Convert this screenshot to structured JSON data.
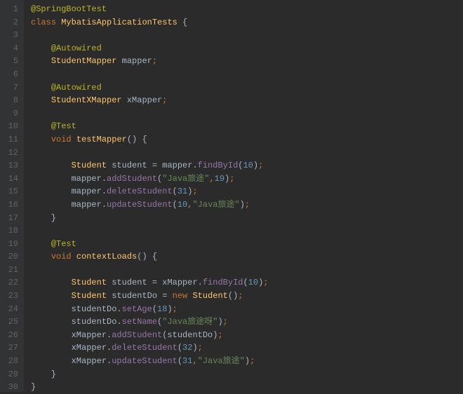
{
  "lines": [
    {
      "n": 1,
      "segs": [
        {
          "c": "annotation",
          "t": "@SpringBootTest"
        }
      ]
    },
    {
      "n": 2,
      "segs": [
        {
          "c": "keyword",
          "t": "class "
        },
        {
          "c": "type",
          "t": "MybatisApplicationTests"
        },
        {
          "c": "plain",
          "t": " {"
        }
      ]
    },
    {
      "n": 3,
      "segs": []
    },
    {
      "n": 4,
      "segs": [
        {
          "c": "plain",
          "t": "    "
        },
        {
          "c": "annotation",
          "t": "@Autowired"
        }
      ]
    },
    {
      "n": 5,
      "segs": [
        {
          "c": "plain",
          "t": "    "
        },
        {
          "c": "type",
          "t": "StudentMapper"
        },
        {
          "c": "plain",
          "t": " mapper"
        },
        {
          "c": "punct",
          "t": ";"
        }
      ]
    },
    {
      "n": 6,
      "segs": []
    },
    {
      "n": 7,
      "segs": [
        {
          "c": "plain",
          "t": "    "
        },
        {
          "c": "annotation",
          "t": "@Autowired"
        }
      ]
    },
    {
      "n": 8,
      "segs": [
        {
          "c": "plain",
          "t": "    "
        },
        {
          "c": "type",
          "t": "StudentXMapper"
        },
        {
          "c": "plain",
          "t": " xMapper"
        },
        {
          "c": "punct",
          "t": ";"
        }
      ]
    },
    {
      "n": 9,
      "segs": []
    },
    {
      "n": 10,
      "segs": [
        {
          "c": "plain",
          "t": "    "
        },
        {
          "c": "annotation",
          "t": "@Test"
        }
      ]
    },
    {
      "n": 11,
      "segs": [
        {
          "c": "plain",
          "t": "    "
        },
        {
          "c": "keyword",
          "t": "void "
        },
        {
          "c": "method",
          "t": "testMapper"
        },
        {
          "c": "plain",
          "t": "() {"
        }
      ]
    },
    {
      "n": 12,
      "segs": []
    },
    {
      "n": 13,
      "segs": [
        {
          "c": "plain",
          "t": "        "
        },
        {
          "c": "type",
          "t": "Student"
        },
        {
          "c": "plain",
          "t": " student "
        },
        {
          "c": "op",
          "t": "="
        },
        {
          "c": "plain",
          "t": " mapper."
        },
        {
          "c": "methodcall",
          "t": "findById"
        },
        {
          "c": "plain",
          "t": "("
        },
        {
          "c": "number",
          "t": "10"
        },
        {
          "c": "plain",
          "t": ")"
        },
        {
          "c": "punct",
          "t": ";"
        }
      ]
    },
    {
      "n": 14,
      "segs": [
        {
          "c": "plain",
          "t": "        mapper."
        },
        {
          "c": "methodcall",
          "t": "addStudent"
        },
        {
          "c": "plain",
          "t": "("
        },
        {
          "c": "string",
          "t": "\"Java旅途\""
        },
        {
          "c": "punct",
          "t": ","
        },
        {
          "c": "number",
          "t": "19"
        },
        {
          "c": "plain",
          "t": ")"
        },
        {
          "c": "punct",
          "t": ";"
        }
      ]
    },
    {
      "n": 15,
      "segs": [
        {
          "c": "plain",
          "t": "        mapper."
        },
        {
          "c": "methodcall",
          "t": "deleteStudent"
        },
        {
          "c": "plain",
          "t": "("
        },
        {
          "c": "number",
          "t": "31"
        },
        {
          "c": "plain",
          "t": ")"
        },
        {
          "c": "punct",
          "t": ";"
        }
      ]
    },
    {
      "n": 16,
      "segs": [
        {
          "c": "plain",
          "t": "        mapper."
        },
        {
          "c": "methodcall",
          "t": "updateStudent"
        },
        {
          "c": "plain",
          "t": "("
        },
        {
          "c": "number",
          "t": "10"
        },
        {
          "c": "punct",
          "t": ","
        },
        {
          "c": "string",
          "t": "\"Java旅途\""
        },
        {
          "c": "plain",
          "t": ")"
        },
        {
          "c": "punct",
          "t": ";"
        }
      ]
    },
    {
      "n": 17,
      "segs": [
        {
          "c": "plain",
          "t": "    }"
        }
      ]
    },
    {
      "n": 18,
      "segs": []
    },
    {
      "n": 19,
      "segs": [
        {
          "c": "plain",
          "t": "    "
        },
        {
          "c": "annotation",
          "t": "@Test"
        }
      ]
    },
    {
      "n": 20,
      "segs": [
        {
          "c": "plain",
          "t": "    "
        },
        {
          "c": "keyword",
          "t": "void "
        },
        {
          "c": "method",
          "t": "contextLoads"
        },
        {
          "c": "plain",
          "t": "() {"
        }
      ]
    },
    {
      "n": 21,
      "segs": []
    },
    {
      "n": 22,
      "segs": [
        {
          "c": "plain",
          "t": "        "
        },
        {
          "c": "type",
          "t": "Student"
        },
        {
          "c": "plain",
          "t": " student "
        },
        {
          "c": "op",
          "t": "="
        },
        {
          "c": "plain",
          "t": " xMapper."
        },
        {
          "c": "methodcall",
          "t": "findById"
        },
        {
          "c": "plain",
          "t": "("
        },
        {
          "c": "number",
          "t": "10"
        },
        {
          "c": "plain",
          "t": ")"
        },
        {
          "c": "punct",
          "t": ";"
        }
      ]
    },
    {
      "n": 23,
      "segs": [
        {
          "c": "plain",
          "t": "        "
        },
        {
          "c": "type",
          "t": "Student"
        },
        {
          "c": "plain",
          "t": " studentDo "
        },
        {
          "c": "op",
          "t": "="
        },
        {
          "c": "plain",
          "t": " "
        },
        {
          "c": "keyword",
          "t": "new "
        },
        {
          "c": "type",
          "t": "Student"
        },
        {
          "c": "plain",
          "t": "()"
        },
        {
          "c": "punct",
          "t": ";"
        }
      ]
    },
    {
      "n": 24,
      "segs": [
        {
          "c": "plain",
          "t": "        studentDo."
        },
        {
          "c": "methodcall",
          "t": "setAge"
        },
        {
          "c": "plain",
          "t": "("
        },
        {
          "c": "number",
          "t": "18"
        },
        {
          "c": "plain",
          "t": ")"
        },
        {
          "c": "punct",
          "t": ";"
        }
      ]
    },
    {
      "n": 25,
      "segs": [
        {
          "c": "plain",
          "t": "        studentDo."
        },
        {
          "c": "methodcall",
          "t": "setName"
        },
        {
          "c": "plain",
          "t": "("
        },
        {
          "c": "string",
          "t": "\"Java旅途呀\""
        },
        {
          "c": "plain",
          "t": ")"
        },
        {
          "c": "punct",
          "t": ";"
        }
      ]
    },
    {
      "n": 26,
      "segs": [
        {
          "c": "plain",
          "t": "        xMapper."
        },
        {
          "c": "methodcall",
          "t": "addStudent"
        },
        {
          "c": "plain",
          "t": "(studentDo)"
        },
        {
          "c": "punct",
          "t": ";"
        }
      ]
    },
    {
      "n": 27,
      "segs": [
        {
          "c": "plain",
          "t": "        xMapper."
        },
        {
          "c": "methodcall",
          "t": "deleteStudent"
        },
        {
          "c": "plain",
          "t": "("
        },
        {
          "c": "number",
          "t": "32"
        },
        {
          "c": "plain",
          "t": ")"
        },
        {
          "c": "punct",
          "t": ";"
        }
      ]
    },
    {
      "n": 28,
      "segs": [
        {
          "c": "plain",
          "t": "        xMapper."
        },
        {
          "c": "methodcall",
          "t": "updateStudent"
        },
        {
          "c": "plain",
          "t": "("
        },
        {
          "c": "number",
          "t": "31"
        },
        {
          "c": "punct",
          "t": ","
        },
        {
          "c": "string",
          "t": "\"Java旅途\""
        },
        {
          "c": "plain",
          "t": ")"
        },
        {
          "c": "punct",
          "t": ";"
        }
      ]
    },
    {
      "n": 29,
      "segs": [
        {
          "c": "plain",
          "t": "    }"
        }
      ]
    },
    {
      "n": 30,
      "segs": [
        {
          "c": "plain",
          "t": "}"
        }
      ]
    }
  ]
}
